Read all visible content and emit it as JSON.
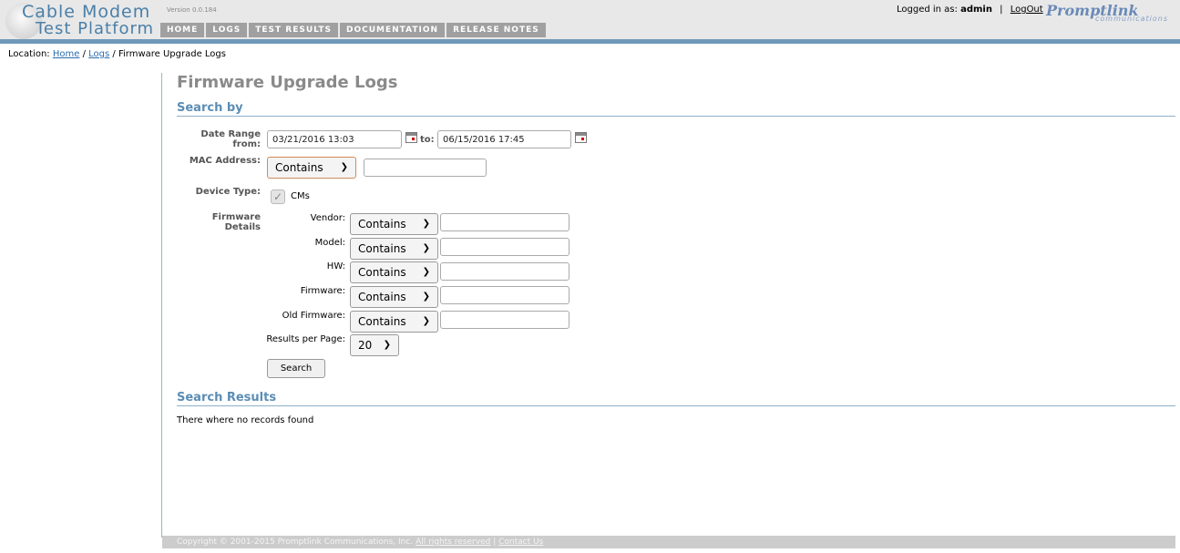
{
  "header": {
    "logo_line1": "Cable Modem",
    "logo_line2": "Test Platform",
    "version": "Version 0.0.184",
    "nav": [
      "HOME",
      "LOGS",
      "TEST RESULTS",
      "DOCUMENTATION",
      "RELEASE NOTES"
    ],
    "logged_in_label": "Logged in as:",
    "username": "admin",
    "separator": "|",
    "logout": "LogOut",
    "brand_name": "Promptlink",
    "brand_sub": "communications"
  },
  "breadcrumb": {
    "prefix": "Location:",
    "home": "Home",
    "sep1": "/",
    "logs": "Logs",
    "sep2": "/",
    "current": "Firmware Upgrade Logs"
  },
  "main": {
    "title": "Firmware Upgrade Logs",
    "search_by": "Search by",
    "date_range_label": "Date Range from:",
    "date_from": "03/21/2016 13:03",
    "date_to_label": "to:",
    "date_to": "06/15/2016 17:45",
    "mac_label": "MAC Address:",
    "mac_operator": "Contains",
    "mac_value": "",
    "device_type_label": "Device Type:",
    "device_type_option": "CMs",
    "device_type_checked": true,
    "firmware_details_label": "Firmware Details",
    "fields": [
      {
        "label": "Vendor:",
        "operator": "Contains",
        "value": ""
      },
      {
        "label": "Model:",
        "operator": "Contains",
        "value": ""
      },
      {
        "label": "HW:",
        "operator": "Contains",
        "value": ""
      },
      {
        "label": "Firmware:",
        "operator": "Contains",
        "value": ""
      },
      {
        "label": "Old Firmware:",
        "operator": "Contains",
        "value": ""
      }
    ],
    "results_per_page_label": "Results per Page:",
    "results_per_page": "20",
    "search_button": "Search",
    "search_results": "Search Results",
    "no_records": "There where no records found"
  },
  "footer": {
    "copyright": "Copyright © 2001-2015 Promptlink Communications, Inc.",
    "rights": "All rights reserved",
    "sep": "|",
    "contact": "Contact Us"
  }
}
